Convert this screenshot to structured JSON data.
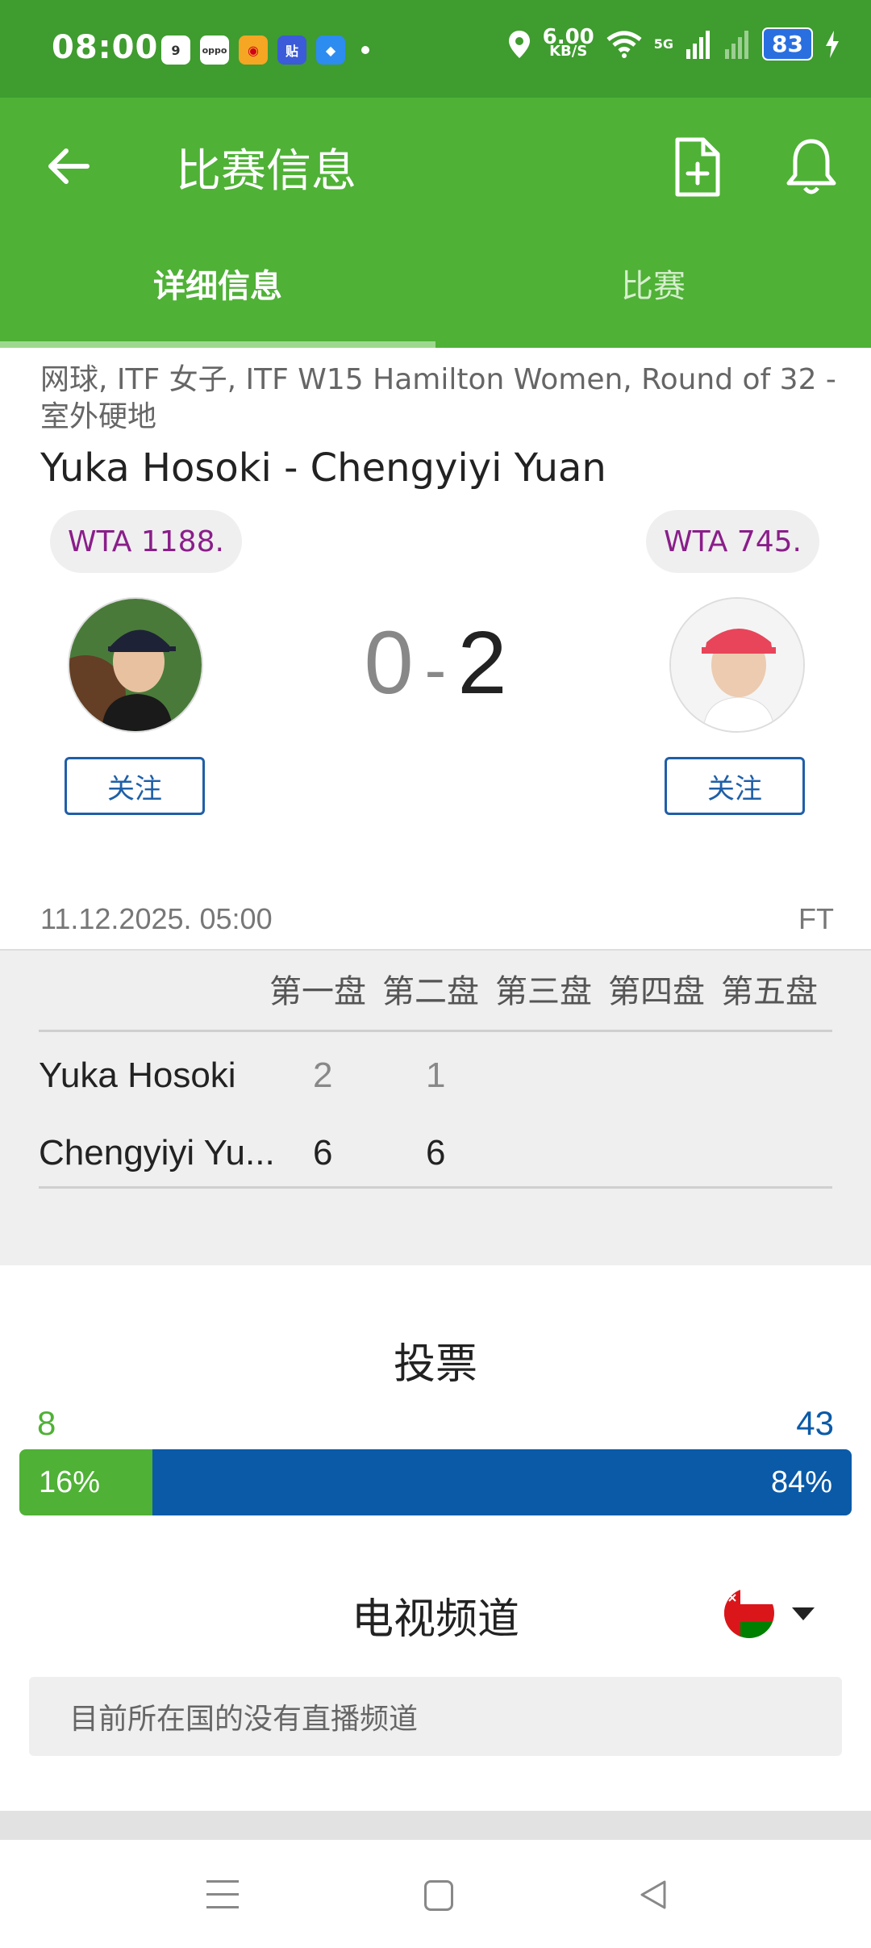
{
  "status_bar": {
    "time": "08:00",
    "net_speed_value": "6.00",
    "net_speed_unit": "KB/S",
    "network_label": "5G",
    "battery": "83",
    "notif_icon_1": "9",
    "notif_icon_2": "oppo",
    "notif_icon_4": "贴"
  },
  "app_bar": {
    "title": "比赛信息",
    "icons": [
      "back-arrow-icon",
      "add-document-icon",
      "bell-icon"
    ]
  },
  "tabs": [
    {
      "label": "详细信息",
      "active": true
    },
    {
      "label": "比赛",
      "active": false
    }
  ],
  "match": {
    "breadcrumb": "网球, ITF 女子, ITF W15 Hamilton Women, Round of 32 - 室外硬地",
    "title": "Yuka Hosoki - Chengyiyi Yuan",
    "home": {
      "name": "Yuka Hosoki",
      "rank": "WTA 1188.",
      "follow_label": "关注"
    },
    "away": {
      "name": "Chengyiyi Yuan",
      "rank": "WTA 745.",
      "follow_label": "关注"
    },
    "score_home": "0",
    "score_sep": "-",
    "score_away": "2",
    "date": "11.12.2025. 05:00",
    "status": "FT"
  },
  "sets": {
    "headers": [
      "第一盘",
      "第二盘",
      "第三盘",
      "第四盘",
      "第五盘"
    ],
    "rows": [
      {
        "name": "Yuka Hosoki",
        "scores": [
          "2",
          "1"
        ]
      },
      {
        "name": "Chengyiyi Yu...",
        "scores": [
          "6",
          "6"
        ]
      }
    ]
  },
  "vote": {
    "title": "投票",
    "home_count": "8",
    "away_count": "43",
    "home_pct_label": "16%",
    "away_pct_label": "84%",
    "home_fraction": 0.16,
    "colors": {
      "home": "#4fb136",
      "away": "#0a5aa8"
    }
  },
  "tv": {
    "title": "电视频道",
    "country_flag": "oman-flag-icon",
    "message": "目前所在国的没有直播频道"
  },
  "nav_bar": {
    "icons": [
      "menu-icon",
      "home-icon",
      "back-icon"
    ]
  }
}
